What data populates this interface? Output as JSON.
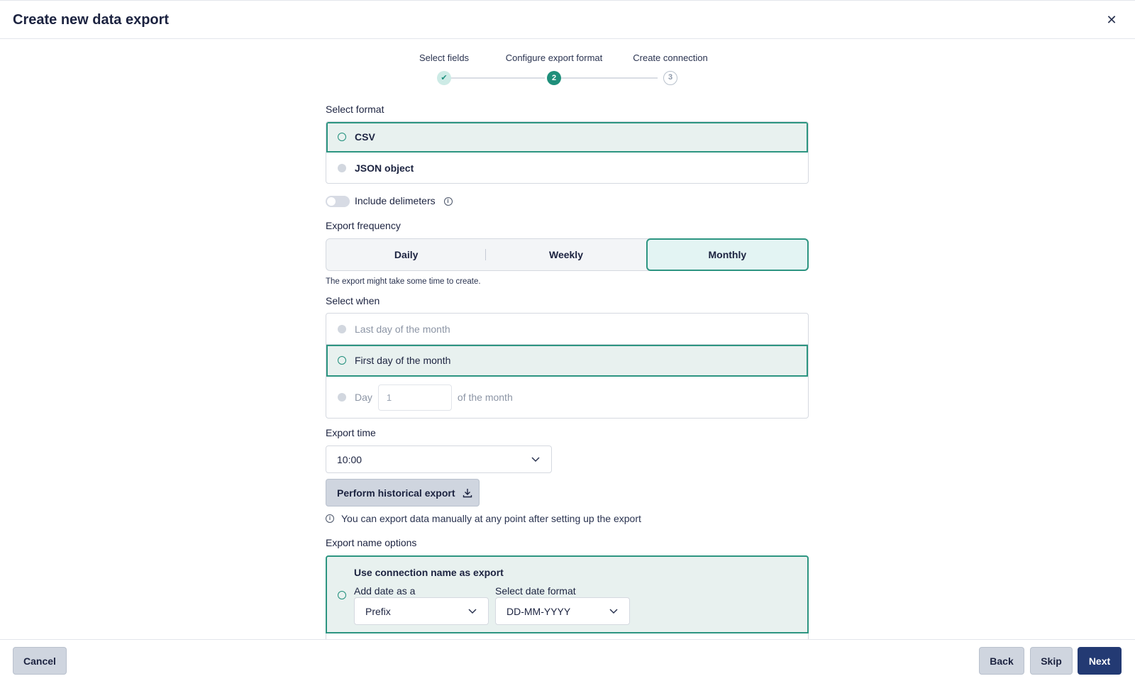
{
  "dialog": {
    "title": "Create new data export"
  },
  "stepper": {
    "steps": [
      {
        "label": "Select fields",
        "marker": "✔",
        "state": "done"
      },
      {
        "label": "Configure export format",
        "marker": "2",
        "state": "active"
      },
      {
        "label": "Create connection",
        "marker": "3",
        "state": "todo"
      }
    ]
  },
  "format": {
    "label": "Select format",
    "options": [
      {
        "label": "CSV",
        "selected": true
      },
      {
        "label": "JSON object",
        "selected": false
      }
    ],
    "delimiters_label": "Include delimeters",
    "delimiters_on": false
  },
  "frequency": {
    "label": "Export frequency",
    "options": [
      "Daily",
      "Weekly",
      "Monthly"
    ],
    "selected": "Monthly",
    "hint": "The export might take some time to create."
  },
  "select_when": {
    "label": "Select when",
    "options": {
      "last_day": "Last day of the month",
      "first_day": "First day of the month",
      "day_prefix": "Day",
      "day_value": "1",
      "day_suffix": "of the month"
    },
    "selected": "First day of the month"
  },
  "export_time": {
    "label": "Export time",
    "value": "10:00"
  },
  "historical": {
    "button_label": "Perform historical export",
    "note": "You can export data manually at any point after setting up the export"
  },
  "name_options": {
    "label": "Export name options",
    "option_title": "Use connection name as export",
    "add_date_label": "Add date as a",
    "add_date_value": "Prefix",
    "date_format_label": "Select date format",
    "date_format_value": "DD-MM-YYYY"
  },
  "footer": {
    "cancel_label": "Cancel",
    "back_label": "Back",
    "skip_label": "Skip",
    "next_label": "Next"
  },
  "colors": {
    "accent": "#1f8f7b",
    "primary": "#233a73",
    "selected_bg": "#e8f1ef"
  }
}
